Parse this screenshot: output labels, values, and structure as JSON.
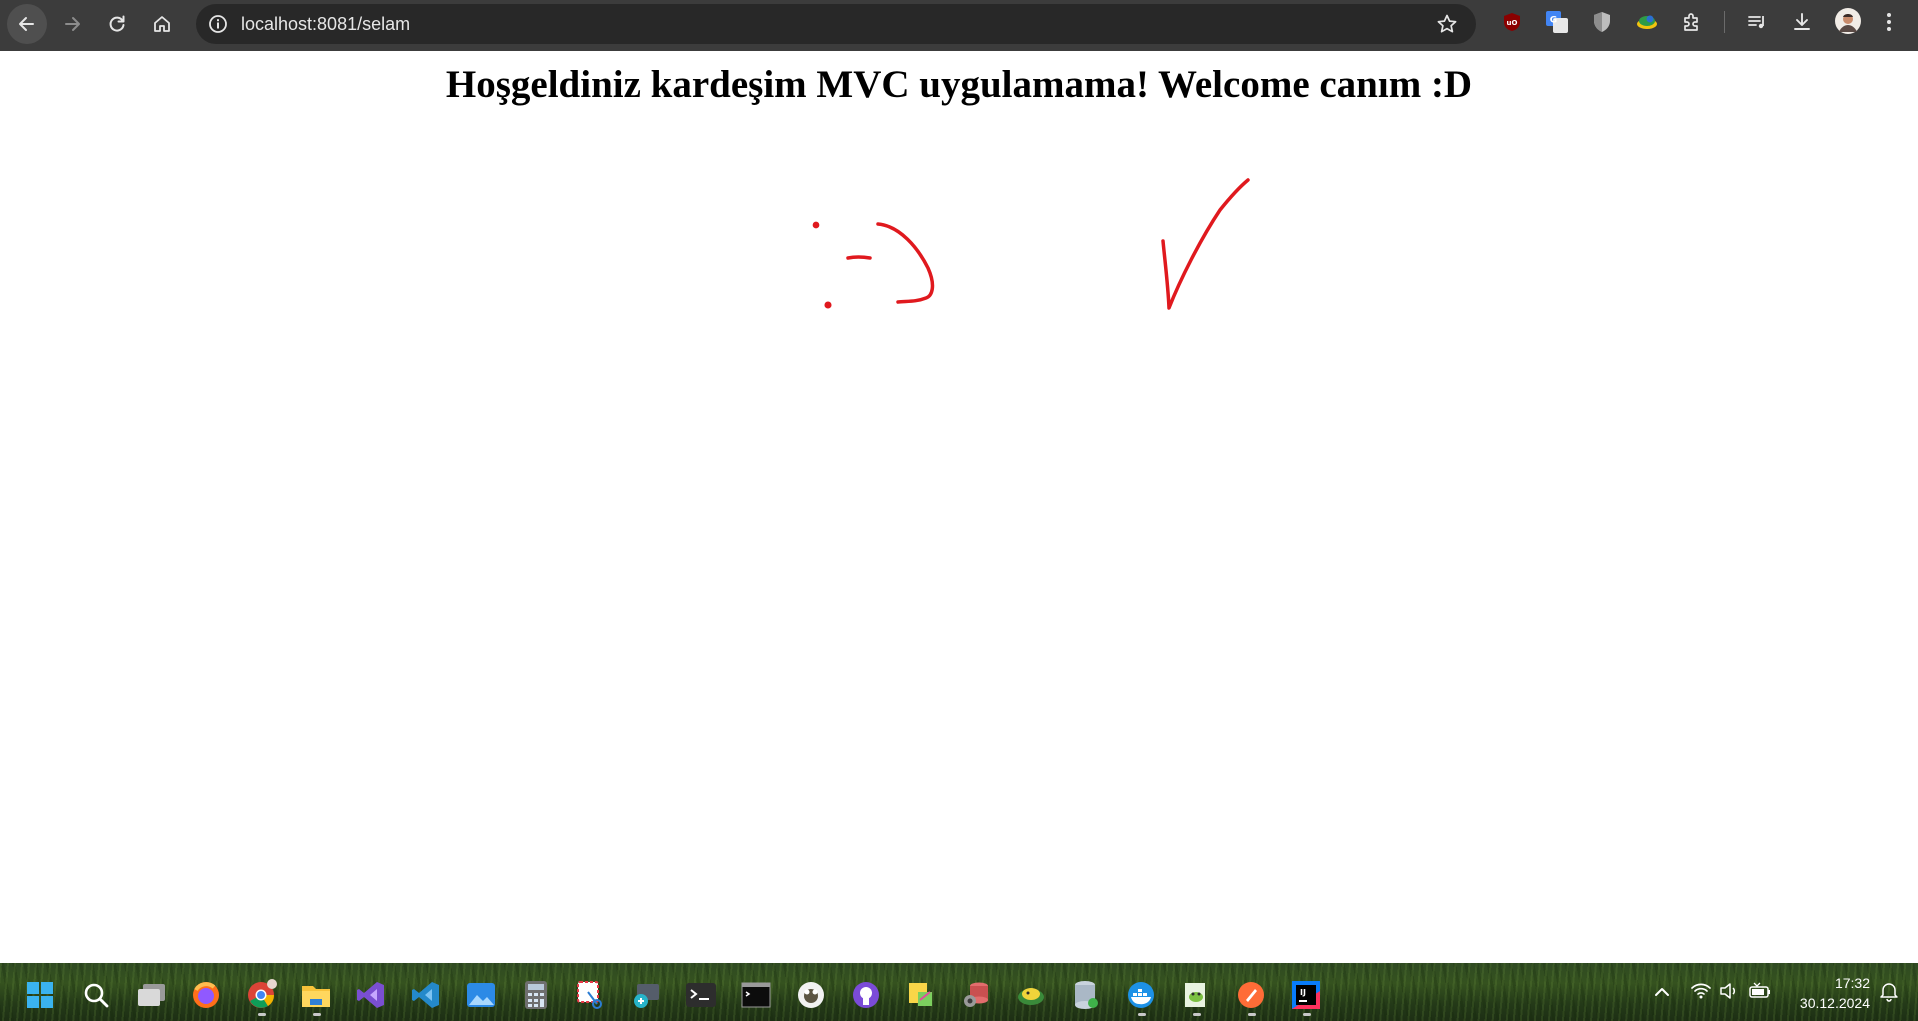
{
  "browser": {
    "url": "localhost:8081/selam"
  },
  "page": {
    "heading": "Hoşgeldiniz kardeşim MVC uygulamama! Welcome canım :D"
  },
  "taskbar": {
    "clock_time": "17:32",
    "clock_date": "30.12.2024",
    "pinned_apps": [
      "windows-start-icon",
      "search-icon",
      "task-view-icon",
      "firefox-icon",
      "chrome-icon",
      "file-explorer-icon",
      "visual-studio-icon",
      "vscode-icon",
      "photos-icon",
      "calculator-icon",
      "snipping-tool-icon",
      "remote-desktop-icon",
      "terminal-icon",
      "command-prompt-icon",
      "gimp-icon",
      "github-desktop-icon",
      "sticky-notes-icon",
      "database-tool-icon",
      "python-icon",
      "sql-server-icon",
      "docker-icon",
      "notepad-plus-plus-icon",
      "postman-icon",
      "intellij-idea-icon"
    ]
  },
  "colors": {
    "toolbar_bg": "#3c3c3c",
    "omnibox_bg": "#282828",
    "drawing_stroke": "#e0191e"
  }
}
